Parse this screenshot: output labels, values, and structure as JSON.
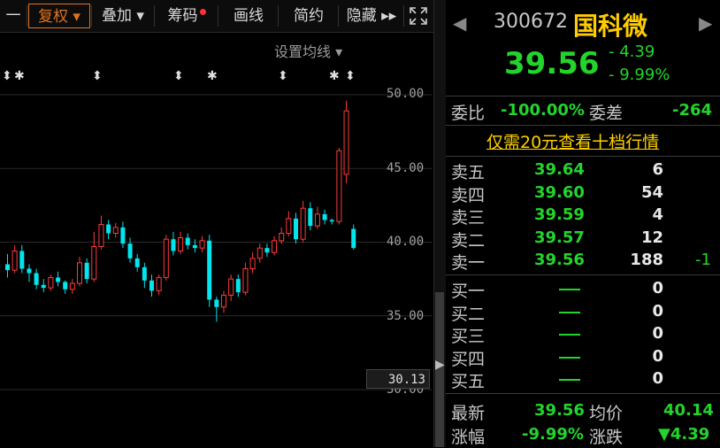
{
  "toolbar": {
    "items": [
      {
        "label": "一"
      },
      {
        "label": "复权 ▾"
      },
      {
        "label": "叠加 ▾"
      },
      {
        "label": "筹码"
      },
      {
        "label": "画线"
      },
      {
        "label": "简约"
      },
      {
        "label": "隐藏 ▸▸"
      }
    ],
    "expand_icon": "expand-icon"
  },
  "chart": {
    "settings_label": "设置均线 ▾",
    "price_labels": [
      "50.00",
      "45.00",
      "40.00",
      "35.00",
      "30.00"
    ],
    "current_price_box": "30.13",
    "colors": {
      "up": "#ff3b3b",
      "down": "#00e5ee",
      "grid": "#2a2a2a"
    }
  },
  "chart_data": {
    "type": "candlestick",
    "ylim": [
      30,
      50
    ],
    "candles": [
      [
        38.5,
        38.1,
        39.2,
        37.6
      ],
      [
        38.1,
        39.4,
        39.8,
        37.9
      ],
      [
        39.4,
        38.2,
        39.8,
        37.9
      ],
      [
        38.2,
        37.9,
        38.5,
        37.3
      ],
      [
        37.9,
        37.1,
        38.2,
        36.8
      ],
      [
        37.1,
        36.9,
        37.5,
        36.6
      ],
      [
        36.9,
        37.6,
        37.8,
        36.7
      ],
      [
        37.6,
        37.3,
        38.0,
        37.0
      ],
      [
        37.3,
        36.8,
        37.4,
        36.5
      ],
      [
        36.8,
        37.2,
        37.5,
        36.5
      ],
      [
        37.2,
        38.6,
        39.0,
        37.0
      ],
      [
        38.6,
        37.5,
        38.9,
        37.2
      ],
      [
        37.5,
        39.7,
        40.7,
        37.3
      ],
      [
        39.7,
        41.2,
        41.8,
        39.5
      ],
      [
        41.2,
        40.6,
        41.5,
        40.2
      ],
      [
        40.6,
        41.0,
        41.3,
        40.3
      ],
      [
        41.0,
        39.9,
        41.4,
        39.6
      ],
      [
        39.9,
        38.9,
        40.3,
        38.6
      ],
      [
        38.9,
        38.3,
        39.2,
        38.0
      ],
      [
        38.3,
        37.4,
        38.6,
        36.9
      ],
      [
        37.4,
        36.7,
        37.8,
        36.3
      ],
      [
        36.7,
        37.6,
        37.8,
        36.4
      ],
      [
        37.6,
        40.2,
        40.5,
        37.4
      ],
      [
        40.2,
        39.4,
        40.7,
        39.1
      ],
      [
        39.4,
        40.3,
        40.7,
        39.2
      ],
      [
        40.3,
        39.8,
        40.6,
        39.5
      ],
      [
        39.8,
        39.6,
        40.2,
        39.3
      ],
      [
        39.6,
        40.1,
        40.4,
        39.3
      ],
      [
        40.1,
        36.1,
        40.5,
        35.6
      ],
      [
        36.1,
        35.6,
        36.3,
        34.6
      ],
      [
        35.6,
        36.4,
        36.7,
        35.2
      ],
      [
        36.4,
        37.5,
        37.8,
        36.0
      ],
      [
        37.5,
        36.6,
        37.8,
        36.3
      ],
      [
        36.6,
        38.2,
        38.6,
        36.4
      ],
      [
        38.2,
        38.9,
        39.3,
        37.9
      ],
      [
        38.9,
        39.6,
        39.9,
        38.6
      ],
      [
        39.6,
        39.3,
        39.9,
        39.0
      ],
      [
        39.3,
        40.1,
        40.4,
        39.1
      ],
      [
        40.1,
        40.6,
        41.0,
        39.9
      ],
      [
        40.6,
        41.6,
        42.1,
        40.4
      ],
      [
        41.6,
        40.2,
        42.0,
        39.9
      ],
      [
        40.2,
        42.3,
        42.8,
        40.0
      ],
      [
        42.3,
        41.1,
        42.7,
        40.8
      ],
      [
        41.1,
        41.9,
        42.4,
        40.9
      ],
      [
        41.9,
        41.5,
        42.2,
        41.2
      ],
      [
        41.5,
        41.4,
        41.6,
        41.2
      ],
      [
        41.4,
        46.2,
        46.4,
        41.2
      ],
      [
        44.6,
        48.9,
        49.6,
        44.0
      ],
      [
        40.9,
        39.6,
        41.2,
        39.5
      ]
    ],
    "markers": [
      "⬍",
      "✱",
      "⬍",
      "⬍",
      "✱",
      "⬍",
      "✱",
      "⬍"
    ]
  },
  "quote": {
    "prev_nav_icon": "left-arrow-icon",
    "next_nav_icon": "right-arrow-icon",
    "code": "300672",
    "name": "国科微",
    "price": "39.56",
    "change": "- 4.39",
    "change_pct": "- 9.99%",
    "weibi_label": "委比",
    "weibi_value": "-100.00%",
    "weicha_label": "委差",
    "weicha_value": "-264",
    "promo": "仅需20元查看十档行情"
  },
  "orderbook": {
    "asks": [
      {
        "label": "卖五",
        "price": "39.64",
        "volume": "6",
        "delta": ""
      },
      {
        "label": "卖四",
        "price": "39.60",
        "volume": "54",
        "delta": ""
      },
      {
        "label": "卖三",
        "price": "39.59",
        "volume": "4",
        "delta": ""
      },
      {
        "label": "卖二",
        "price": "39.57",
        "volume": "12",
        "delta": ""
      },
      {
        "label": "卖一",
        "price": "39.56",
        "volume": "188",
        "delta": "-1"
      }
    ],
    "bids": [
      {
        "label": "买一",
        "volume": "0"
      },
      {
        "label": "买二",
        "volume": "0"
      },
      {
        "label": "买三",
        "volume": "0"
      },
      {
        "label": "买四",
        "volume": "0"
      },
      {
        "label": "买五",
        "volume": "0"
      }
    ]
  },
  "footer": {
    "latest_label": "最新",
    "latest_value": "39.56",
    "avg_label": "均价",
    "avg_value": "40.14",
    "pct_label": "涨幅",
    "pct_value": "-9.99%",
    "chg_label": "涨跌",
    "chg_value": "▼4.39"
  }
}
